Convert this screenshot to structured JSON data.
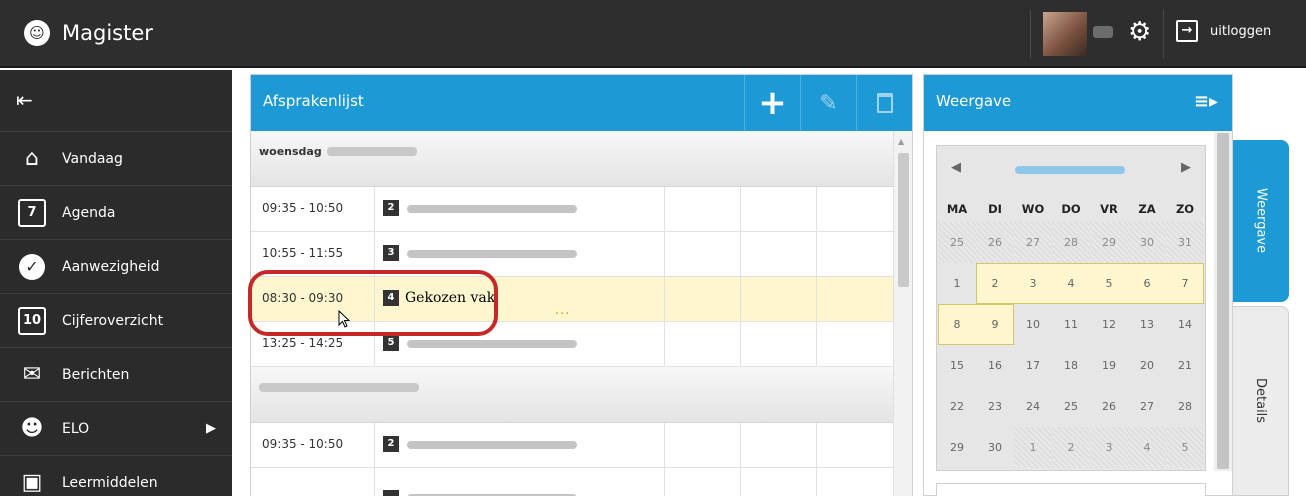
{
  "app": {
    "title": "Magister"
  },
  "topbar": {
    "logout_label": "uitloggen"
  },
  "sidebar": {
    "items": [
      {
        "label": "Vandaag",
        "icon": "home-icon"
      },
      {
        "label": "Agenda",
        "icon": "calendar-icon",
        "icon_text": "7"
      },
      {
        "label": "Aanwezigheid",
        "icon": "check-icon"
      },
      {
        "label": "Cijferoverzicht",
        "icon": "grades-icon",
        "icon_text": "10"
      },
      {
        "label": "Berichten",
        "icon": "mail-icon"
      },
      {
        "label": "ELO",
        "icon": "people-icon"
      },
      {
        "label": "Leermiddelen",
        "icon": "books-icon"
      }
    ]
  },
  "afspraken": {
    "title": "Afsprakenlijst",
    "day1_label": "woensdag",
    "rows": [
      {
        "time": "09:35 - 10:50",
        "num": "2"
      },
      {
        "time": "10:55 - 11:55",
        "num": "3"
      },
      {
        "time": "08:30 - 09:30",
        "num": "4",
        "vak": "Gekozen vak",
        "extra": "..."
      },
      {
        "time": "13:25 - 14:25",
        "num": "5"
      },
      {
        "time": "09:35 - 10:50",
        "num": "2"
      }
    ]
  },
  "weergave": {
    "title": "Weergave",
    "calendar": {
      "weekdays": [
        "MA",
        "DI",
        "WO",
        "DO",
        "VR",
        "ZA",
        "ZO"
      ],
      "weeks": [
        [
          "25",
          "26",
          "27",
          "28",
          "29",
          "30",
          "31"
        ],
        [
          "1",
          "2",
          "3",
          "4",
          "5",
          "6",
          "7"
        ],
        [
          "8",
          "9",
          "10",
          "11",
          "12",
          "13",
          "14"
        ],
        [
          "15",
          "16",
          "17",
          "18",
          "19",
          "20",
          "21"
        ],
        [
          "22",
          "23",
          "24",
          "25",
          "26",
          "27",
          "28"
        ],
        [
          "29",
          "30",
          "1",
          "2",
          "3",
          "4",
          "5"
        ]
      ]
    }
  },
  "tabs": {
    "weergave": "Weergave",
    "details": "Details"
  },
  "colors": {
    "accent": "#1d9ad6",
    "selection": "#fdf6cf",
    "annotation": "#c62828",
    "topbar": "#2e2e2e"
  }
}
